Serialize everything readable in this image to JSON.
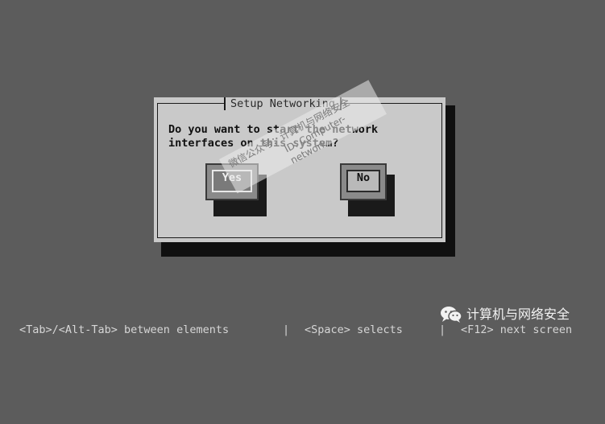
{
  "dialog": {
    "title": "Setup Networking",
    "message_line1": "Do you want to start the network",
    "message_line2": "interfaces on this system?",
    "yes_label": "Yes",
    "no_label": "No"
  },
  "status_bar": {
    "tab_hint": "<Tab>/<Alt-Tab> between elements",
    "sep1": "|",
    "space_hint": "<Space> selects",
    "sep2": "|",
    "f12_hint": "<F12> next screen"
  },
  "watermark": {
    "line1": "微信公众号：计算机与网络安全",
    "line2": "ID: Computer-network"
  },
  "logo": {
    "icon": "wechat-icon",
    "text": "计算机与网络安全"
  },
  "colors": {
    "background": "#5c5c5c",
    "dialog": "#c9c9c9",
    "shadow": "#101010"
  }
}
